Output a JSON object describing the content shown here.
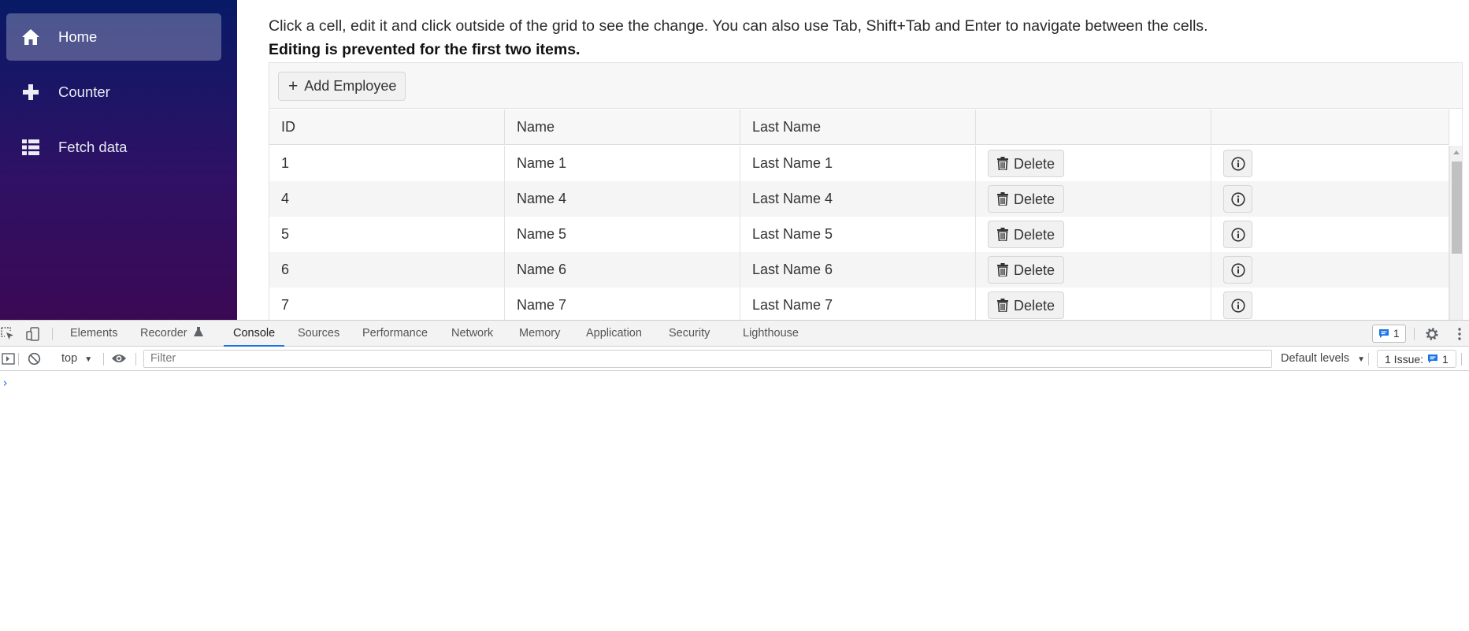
{
  "sidebar": {
    "items": [
      {
        "label": "Home",
        "icon": "home-icon",
        "active": true
      },
      {
        "label": "Counter",
        "icon": "plus-icon",
        "active": false
      },
      {
        "label": "Fetch data",
        "icon": "list-icon",
        "active": false
      }
    ]
  },
  "main": {
    "intro": "Click a cell, edit it and click outside of the grid to see the change. You can also use Tab, Shift+Tab and Enter to navigate between the cells.",
    "note": "Editing is prevented for the first two items."
  },
  "grid": {
    "add_button_label": "Add Employee",
    "columns": [
      "ID",
      "Name",
      "Last Name",
      "",
      ""
    ],
    "delete_label": "Delete",
    "rows": [
      {
        "id": "1",
        "name": "Name 1",
        "last_name": "Last Name 1"
      },
      {
        "id": "4",
        "name": "Name 4",
        "last_name": "Last Name 4"
      },
      {
        "id": "5",
        "name": "Name 5",
        "last_name": "Last Name 5"
      },
      {
        "id": "6",
        "name": "Name 6",
        "last_name": "Last Name 6"
      },
      {
        "id": "7",
        "name": "Name 7",
        "last_name": "Last Name 7"
      }
    ]
  },
  "devtools": {
    "tabs": [
      "Elements",
      "Recorder",
      "Console",
      "Sources",
      "Performance",
      "Network",
      "Memory",
      "Application",
      "Security",
      "Lighthouse"
    ],
    "active_tab": "Console",
    "issue_badge_count": "1",
    "context": "top",
    "filter_placeholder": "Filter",
    "levels_label": "Default levels",
    "issues_label": "1 Issue:",
    "issues_count": "1",
    "prompt_glyph": "›"
  },
  "colors": {
    "sidebar_top": "#071a66",
    "sidebar_bottom": "#3b0954",
    "accent": "#1a73e8"
  }
}
